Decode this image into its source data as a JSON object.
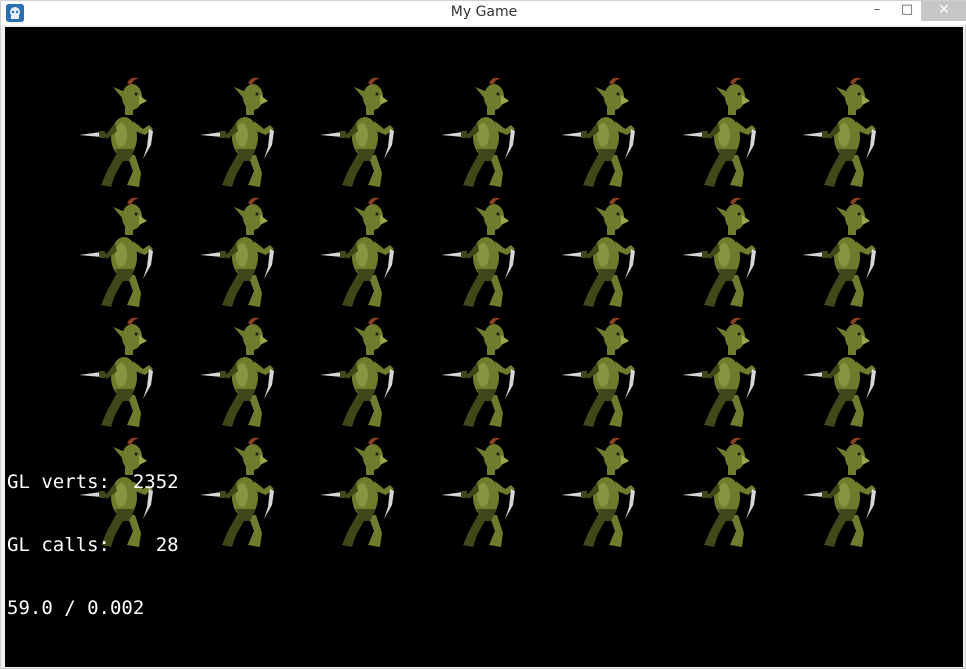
{
  "window": {
    "title": "My Game",
    "controls": {
      "minimize": "–",
      "maximize": "□",
      "close": "✕"
    }
  },
  "scene": {
    "sprite_name": "goblin",
    "rows": 4,
    "cols": 7,
    "background_color": "#000000"
  },
  "hud": {
    "lines": [
      "GL verts:  2352",
      "GL calls:    28",
      "59.0 / 0.002"
    ],
    "text_color": "#ffffff"
  },
  "colors": {
    "goblin_skin": "#6f7c2e",
    "goblin_dark": "#3e4818",
    "goblin_light": "#9aa54b",
    "blade": "#d6d6d6",
    "hair": "#8a3e22"
  }
}
